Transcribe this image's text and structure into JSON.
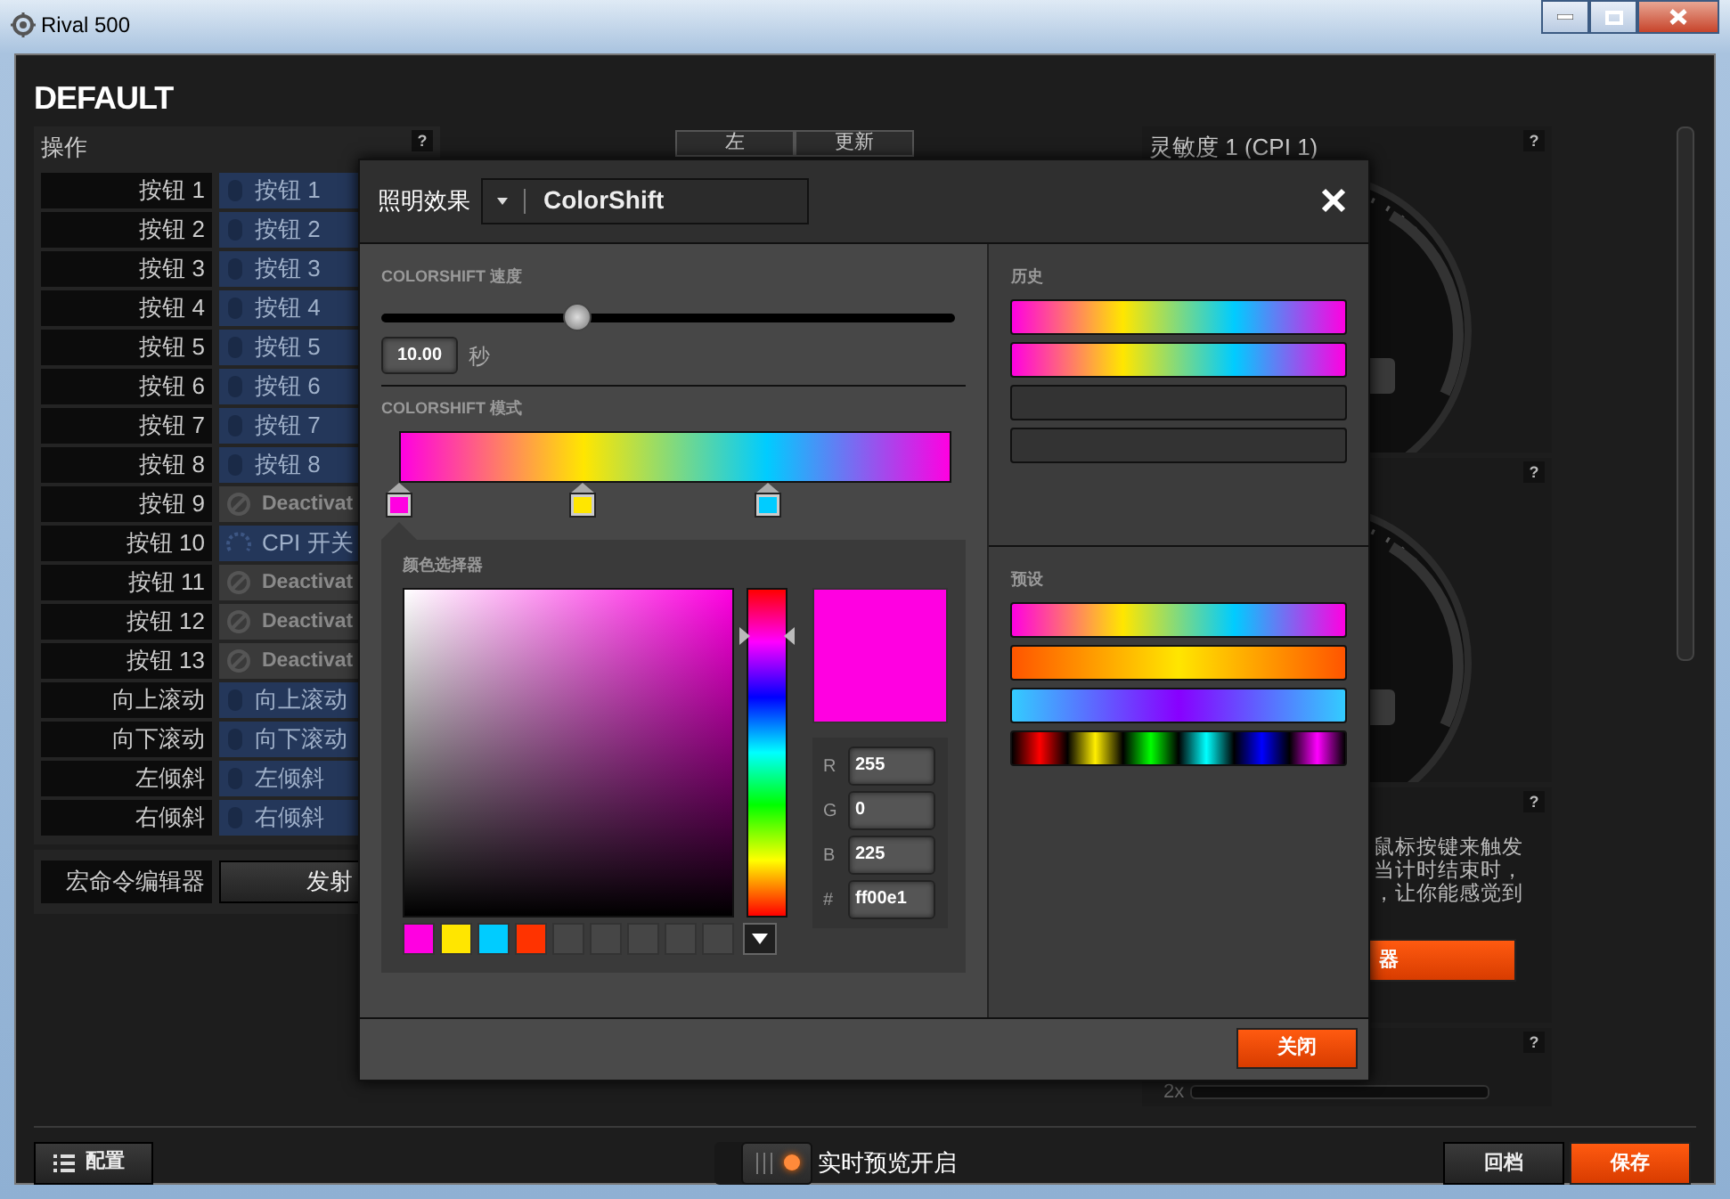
{
  "window": {
    "title": "Rival 500"
  },
  "profile": {
    "title": "DEFAULT"
  },
  "actions": {
    "title": "操作",
    "help": "?",
    "rows": [
      {
        "label": "按钮 1",
        "kind": "button",
        "assignment": "按钮 1"
      },
      {
        "label": "按钮 2",
        "kind": "button",
        "assignment": "按钮 2"
      },
      {
        "label": "按钮 3",
        "kind": "button",
        "assignment": "按钮 3"
      },
      {
        "label": "按钮 4",
        "kind": "button",
        "assignment": "按钮 4"
      },
      {
        "label": "按钮 5",
        "kind": "button",
        "assignment": "按钮 5"
      },
      {
        "label": "按钮 6",
        "kind": "button",
        "assignment": "按钮 6"
      },
      {
        "label": "按钮 7",
        "kind": "button",
        "assignment": "按钮 7"
      },
      {
        "label": "按钮 8",
        "kind": "button",
        "assignment": "按钮 8"
      },
      {
        "label": "按钮 9",
        "kind": "deactivated",
        "assignment": "Deactivat"
      },
      {
        "label": "按钮 10",
        "kind": "cpi",
        "assignment": "CPI 开关"
      },
      {
        "label": "按钮 11",
        "kind": "deactivated",
        "assignment": "Deactivat"
      },
      {
        "label": "按钮 12",
        "kind": "deactivated",
        "assignment": "Deactivat"
      },
      {
        "label": "按钮 13",
        "kind": "deactivated",
        "assignment": "Deactivat"
      },
      {
        "label": "向上滚动",
        "kind": "button",
        "assignment": "向上滚动"
      },
      {
        "label": "向下滚动",
        "kind": "button",
        "assignment": "向下滚动"
      },
      {
        "label": "左倾斜",
        "kind": "button",
        "assignment": "左倾斜"
      },
      {
        "label": "右倾斜",
        "kind": "button",
        "assignment": "右倾斜"
      }
    ]
  },
  "macro": {
    "label": "宏命令编辑器",
    "button": "发射"
  },
  "tabs": [
    {
      "label": "左"
    },
    {
      "label": "更新"
    }
  ],
  "sensitivity": {
    "title": "灵敏度 1 (CPI 1)",
    "help": "?"
  },
  "sensitivity_2": {
    "help": "?"
  },
  "timer": {
    "help": "?",
    "lines": [
      "鼠标按键来触发",
      "当计时结束时，",
      "，让你能感觉到"
    ],
    "button": "器"
  },
  "panel_4": {
    "help": "?",
    "label": "2x"
  },
  "dialog": {
    "title": "照明效果",
    "effect": "ColorShift",
    "speed": {
      "label": "COLORSHIFT 速度",
      "level": 0.34,
      "value": "10.00",
      "unit": "秒"
    },
    "mode": {
      "label": "COLORSHIFT 模式",
      "stops": [
        {
          "color": "#ff00e1"
        },
        {
          "color": "#ffe600"
        },
        {
          "color": "#00ccff"
        }
      ]
    },
    "picker": {
      "label": "颜色选择器",
      "color": "#ff00e1",
      "fields": [
        {
          "label": "R",
          "value": "255"
        },
        {
          "label": "G",
          "value": "0"
        },
        {
          "label": "B",
          "value": "225"
        },
        {
          "label": "#",
          "value": "ff00e1"
        }
      ],
      "swatches": [
        {
          "kind": "color",
          "color": "#ff00e1"
        },
        {
          "kind": "color",
          "color": "#ffe600"
        },
        {
          "kind": "color",
          "color": "#00ccff"
        },
        {
          "kind": "color",
          "color": "#ff3300"
        },
        {
          "kind": "empty"
        },
        {
          "kind": "empty"
        },
        {
          "kind": "empty"
        },
        {
          "kind": "empty"
        },
        {
          "kind": "empty"
        }
      ]
    },
    "history": {
      "label": "历史",
      "items": [
        {
          "kind": "rainbow"
        },
        {
          "kind": "rainbow"
        },
        {
          "kind": "empty"
        },
        {
          "kind": "empty"
        }
      ]
    },
    "presets": {
      "label": "预设",
      "items": [
        {
          "kind": "rainbow"
        },
        {
          "kind": "fire"
        },
        {
          "kind": "violet"
        },
        {
          "kind": "spectrum"
        }
      ]
    },
    "close_button": "关闭"
  },
  "footer": {
    "config": "配置",
    "preview_toggle": {
      "label": "实时预览开启",
      "on": true
    },
    "revert": "回档",
    "save": "保存"
  }
}
